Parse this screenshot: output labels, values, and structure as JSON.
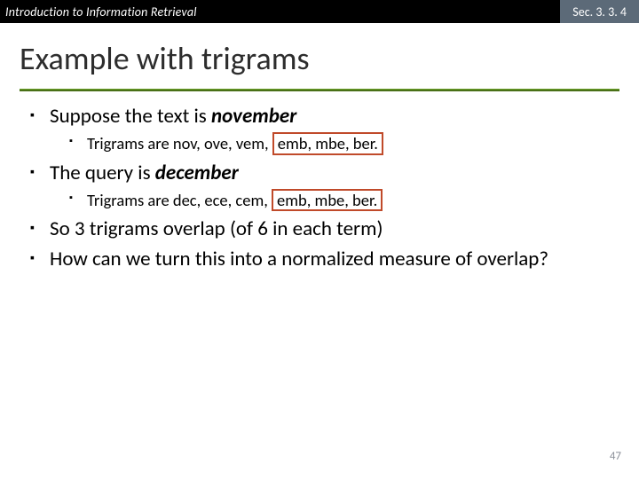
{
  "header": {
    "left": "Introduction to Information Retrieval",
    "right": "Sec. 3. 3. 4"
  },
  "title": "Example with trigrams",
  "bullets": {
    "b1": {
      "pre": "Suppose the text is ",
      "em": "november"
    },
    "b1a": {
      "pre": "Trigrams are ",
      "plain": "nov, ove, vem, ",
      "boxed": "emb, mbe, ber."
    },
    "b2": {
      "pre": "The query is ",
      "em": "december"
    },
    "b2a": {
      "pre": "Trigrams are ",
      "plain": "dec, ece, cem, ",
      "boxed": "emb, mbe, ber."
    },
    "b3": "So 3 trigrams overlap (of 6 in each term)",
    "b4": "How can we turn this into a normalized measure of overlap?"
  },
  "pagenum": "47"
}
